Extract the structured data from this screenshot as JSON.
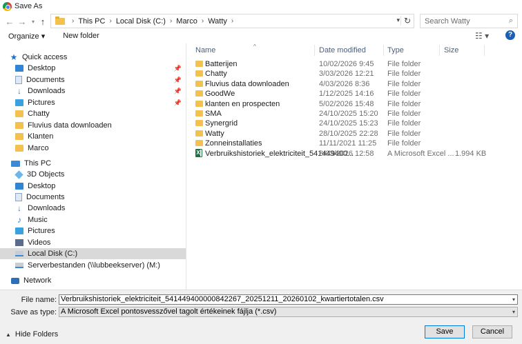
{
  "window": {
    "title": "Save As"
  },
  "address": {
    "crumbs": [
      "This PC",
      "Local Disk (C:)",
      "Marco",
      "Watty"
    ],
    "search_placeholder": "Search Watty"
  },
  "toolbar": {
    "organize": "Organize ▾",
    "new_folder": "New folder"
  },
  "nav": {
    "quick_access": "Quick access",
    "quick_items": [
      {
        "label": "Desktop",
        "pinned": true
      },
      {
        "label": "Documents",
        "pinned": true
      },
      {
        "label": "Downloads",
        "pinned": true
      },
      {
        "label": "Pictures",
        "pinned": true
      },
      {
        "label": "Chatty"
      },
      {
        "label": "Fluvius data downloaden"
      },
      {
        "label": "Klanten"
      },
      {
        "label": "Marco"
      }
    ],
    "this_pc": "This PC",
    "pc_items": [
      {
        "label": "3D Objects"
      },
      {
        "label": "Desktop"
      },
      {
        "label": "Documents"
      },
      {
        "label": "Downloads"
      },
      {
        "label": "Music"
      },
      {
        "label": "Pictures"
      },
      {
        "label": "Videos"
      },
      {
        "label": "Local Disk (C:)"
      },
      {
        "label": "Serverbestanden (\\\\lubbeekserver) (M:)"
      }
    ],
    "network": "Network"
  },
  "columns": {
    "name": "Name",
    "date": "Date modified",
    "type": "Type",
    "size": "Size"
  },
  "files": [
    {
      "name": "Batterijen",
      "date": "10/02/2026 9:45",
      "type": "File folder",
      "size": ""
    },
    {
      "name": "Chatty",
      "date": "3/03/2026 12:21",
      "type": "File folder",
      "size": ""
    },
    {
      "name": "Fluvius data downloaden",
      "date": "4/03/2026 8:36",
      "type": "File folder",
      "size": ""
    },
    {
      "name": "GoodWe",
      "date": "1/12/2025 14:16",
      "type": "File folder",
      "size": ""
    },
    {
      "name": "klanten en prospecten",
      "date": "5/02/2026 15:48",
      "type": "File folder",
      "size": ""
    },
    {
      "name": "SMA",
      "date": "24/10/2025 15:20",
      "type": "File folder",
      "size": ""
    },
    {
      "name": "Synergrid",
      "date": "24/10/2025 15:23",
      "type": "File folder",
      "size": ""
    },
    {
      "name": "Watty",
      "date": "28/10/2025 22:28",
      "type": "File folder",
      "size": ""
    },
    {
      "name": "Zonneinstallaties",
      "date": "11/11/2021 11:25",
      "type": "File folder",
      "size": ""
    },
    {
      "name": "Verbruikshistoriek_elektriciteit_541449400...",
      "date": "3/03/2026 12:58",
      "type": "A Microsoft Excel ...",
      "size": "1.994 KB"
    }
  ],
  "bottom": {
    "file_name_label": "File name:",
    "file_name_value": "Verbruikshistoriek_elektriciteit_541449400000842267_20251211_20260102_kwartiertotalen.csv",
    "save_type_label": "Save as type:",
    "save_type_value": "A Microsoft Excel pontosvesszővel tagolt értékeinek fájlja (*.csv)",
    "hide_folders": "Hide Folders",
    "save": "Save",
    "cancel": "Cancel"
  }
}
